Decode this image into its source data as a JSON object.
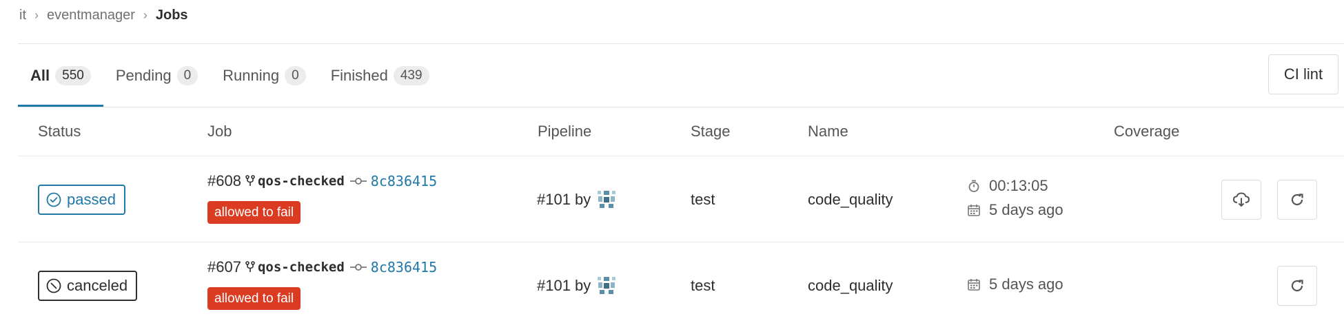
{
  "breadcrumb": {
    "items": [
      "it",
      "eventmanager"
    ],
    "current": "Jobs"
  },
  "tabs": [
    {
      "label": "All",
      "count": "550",
      "active": true
    },
    {
      "label": "Pending",
      "count": "0"
    },
    {
      "label": "Running",
      "count": "0"
    },
    {
      "label": "Finished",
      "count": "439"
    }
  ],
  "ci_lint_label": "CI lint",
  "columns": {
    "status": "Status",
    "job": "Job",
    "pipeline": "Pipeline",
    "stage": "Stage",
    "name": "Name",
    "coverage": "Coverage"
  },
  "jobs": [
    {
      "status": "passed",
      "status_icon": "check-circle-icon",
      "job_id": "#608",
      "ref": "qos-checked",
      "commit": "8c836415",
      "badge": "allowed to fail",
      "pipeline": "#101 by",
      "stage": "test",
      "name": "code_quality",
      "duration": "00:13:05",
      "finished": "5 days ago",
      "actions": [
        "download-artifacts",
        "retry"
      ]
    },
    {
      "status": "canceled",
      "status_icon": "canceled-circle-icon",
      "job_id": "#607",
      "ref": "qos-checked",
      "commit": "8c836415",
      "badge": "allowed to fail",
      "pipeline": "#101 by",
      "stage": "test",
      "name": "code_quality",
      "finished": "5 days ago",
      "actions": [
        "retry"
      ]
    }
  ],
  "colors": {
    "link": "#1f78a8",
    "danger": "#db3b21",
    "passed": "#1f78a8",
    "canceled": "#2e2e2e"
  }
}
